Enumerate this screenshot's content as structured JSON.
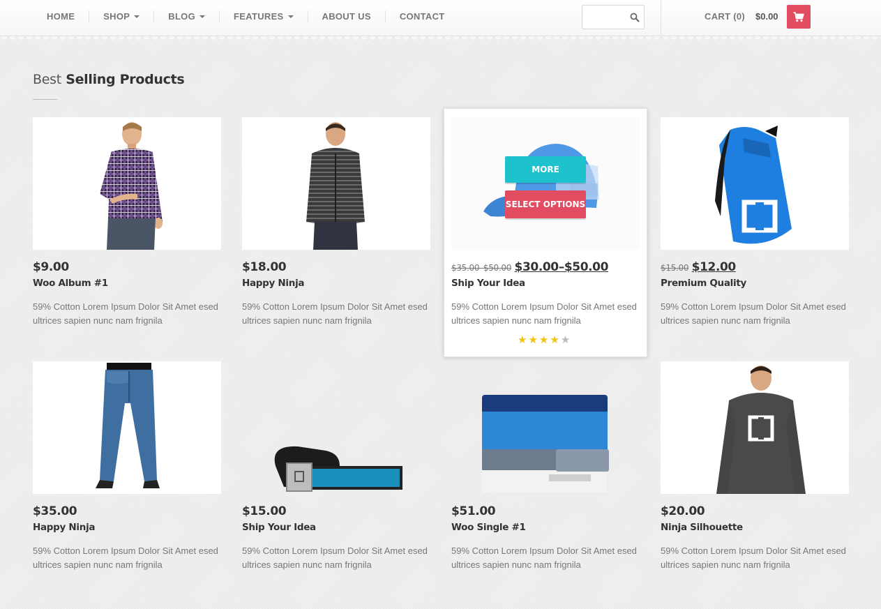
{
  "nav": {
    "items": [
      {
        "label": "HOME",
        "dropdown": false
      },
      {
        "label": "SHOP",
        "dropdown": true
      },
      {
        "label": "BLOG",
        "dropdown": true
      },
      {
        "label": "FEATURES",
        "dropdown": true
      },
      {
        "label": "ABOUT US",
        "dropdown": false
      },
      {
        "label": "CONTACT",
        "dropdown": false
      }
    ]
  },
  "search": {
    "value": "",
    "placeholder": "",
    "icon": "search-icon"
  },
  "cart": {
    "label": "CART",
    "count": "(0)",
    "total": "$0.00",
    "icon": "cart-icon"
  },
  "section": {
    "title_light": "Best",
    "title_bold": "Selling Products"
  },
  "products": [
    {
      "price": "$9.00",
      "old_price": "",
      "name": "Woo Album #1",
      "description": "59% Cotton Lorem Ipsum Dolor Sit Amet esed ultrices sapien nunc nam frignila",
      "image": "plaid-shirt-man"
    },
    {
      "price": "$18.00",
      "old_price": "",
      "name": "Happy Ninja",
      "description": "59% Cotton Lorem Ipsum Dolor Sit Amet esed ultrices sapien nunc nam frignila",
      "image": "striped-hoodie-man"
    },
    {
      "price": "$30.00–$50.00",
      "old_price": "$35.00–$50.00",
      "name": "Ship Your Idea",
      "description": "59% Cotton Lorem Ipsum Dolor Sit Amet esed ultrices sapien nunc nam frignila",
      "image": "blue-cap",
      "more_label": "MORE",
      "options_label": "SELECT OPTIONS",
      "rating": 4,
      "rating_max": 5
    },
    {
      "price": "$12.00",
      "old_price": "$15.00",
      "name": "Premium Quality",
      "description": "59% Cotton Lorem Ipsum Dolor Sit Amet esed ultrices sapien nunc nam frignila",
      "image": "blue-backpack"
    },
    {
      "price": "$35.00",
      "old_price": "",
      "name": "Happy Ninja",
      "description": "59% Cotton Lorem Ipsum Dolor Sit Amet esed ultrices sapien nunc nam frignila",
      "image": "jeans"
    },
    {
      "price": "$15.00",
      "old_price": "",
      "name": "Ship Your Idea",
      "description": "59% Cotton Lorem Ipsum Dolor Sit Amet esed ultrices sapien nunc nam frignila",
      "image": "belt"
    },
    {
      "price": "$51.00",
      "old_price": "",
      "name": "Woo Single #1",
      "description": "59% Cotton Lorem Ipsum Dolor Sit Amet esed ultrices sapien nunc nam frignila",
      "image": "wallet"
    },
    {
      "price": "$20.00",
      "old_price": "",
      "name": "Ninja Silhouette",
      "description": "59% Cotton Lorem Ipsum Dolor Sit Amet esed ultrices sapien nunc nam frignila",
      "image": "grey-hoodie-man"
    }
  ],
  "colors": {
    "accent_red": "#e24c60",
    "accent_teal": "#1ec2cd",
    "star_gold": "#f4c20d",
    "star_empty": "#bbbbbb"
  }
}
